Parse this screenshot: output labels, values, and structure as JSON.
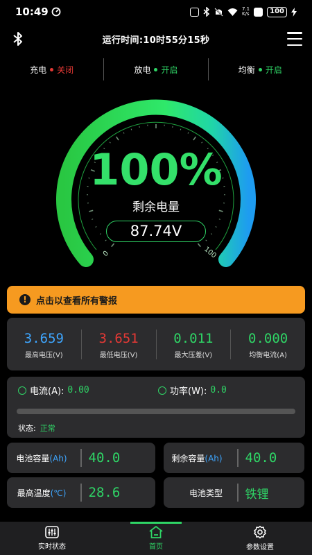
{
  "status_bar": {
    "time": "10:49",
    "signal": "7.1\nK/s",
    "battery": "100"
  },
  "header": {
    "title": "运行时间:10时55分15秒"
  },
  "toggles": [
    {
      "label": "充电",
      "state": "关闭",
      "color": "#e53935"
    },
    {
      "label": "放电",
      "state": "开启",
      "color": "#2fd566"
    },
    {
      "label": "均衡",
      "state": "开启",
      "color": "#2fd566"
    }
  ],
  "gauge": {
    "percent_text": "100%",
    "percent_value": 100,
    "label": "剩余电量",
    "voltage": "87.74V",
    "min_label": "0",
    "max_label": "100"
  },
  "alarm": {
    "text": "点击以查看所有警报",
    "icon": "!"
  },
  "stats": [
    {
      "value": "3.659",
      "label": "最高电压(V)",
      "color": "#3ea6ff"
    },
    {
      "value": "3.651",
      "label": "最低电压(V)",
      "color": "#e53935"
    },
    {
      "value": "0.011",
      "label": "最大压差(V)",
      "color": "#2fd566"
    },
    {
      "value": "0.000",
      "label": "均衡电流(A)",
      "color": "#2fd566"
    }
  ],
  "current": {
    "current_label": "电流(A):",
    "current_value": "0.00",
    "power_label": "功率(W):",
    "power_value": "0.0",
    "state_label": "状态:",
    "state_value": "正常"
  },
  "metrics": {
    "capacity": {
      "label": "电池容量",
      "unit": "(Ah)",
      "value": "40.0"
    },
    "remaining": {
      "label": "剩余容量",
      "unit": "(Ah)",
      "value": "40.0"
    },
    "max_temp": {
      "label": "最高温度",
      "unit": "(℃)",
      "value": "28.6"
    },
    "battery_type": {
      "label": "电池类型",
      "value": "铁锂"
    }
  },
  "nav": [
    {
      "label": "实时状态",
      "icon": "sliders-icon"
    },
    {
      "label": "首页",
      "icon": "home-icon"
    },
    {
      "label": "参数设置",
      "icon": "gear-icon"
    }
  ],
  "colors": {
    "green": "#2fd566",
    "red": "#e53935",
    "blue": "#3ea6ff",
    "orange": "#f69a20",
    "card": "#2c2c2e"
  }
}
